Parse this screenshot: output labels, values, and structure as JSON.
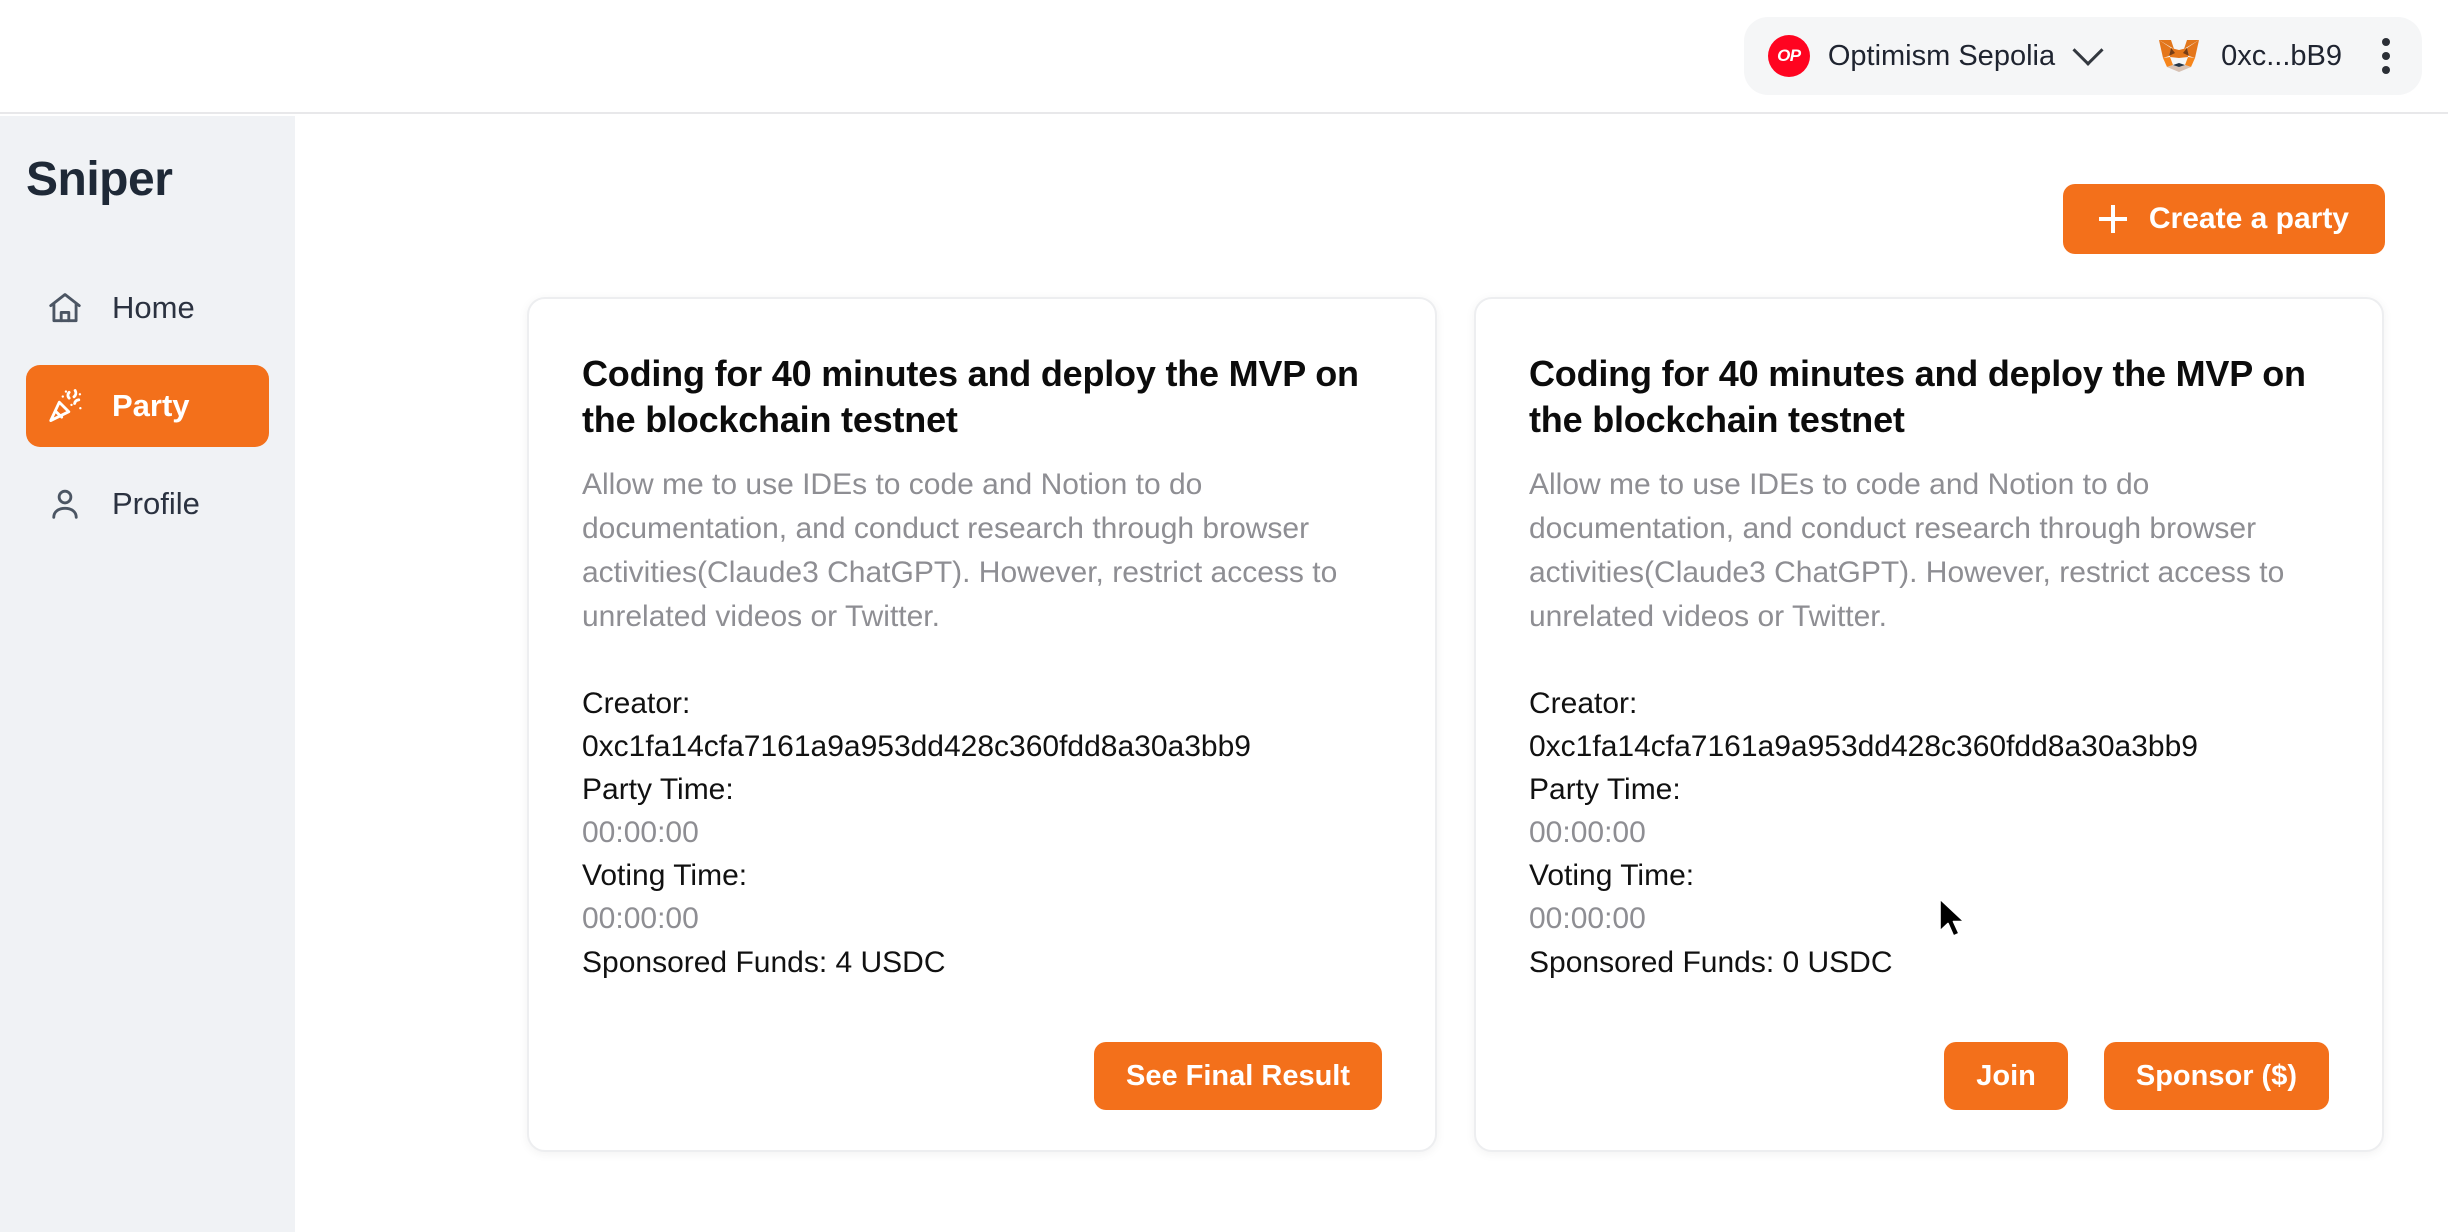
{
  "header": {
    "network": {
      "badge_text": "OP",
      "badge_color": "#ff0420",
      "name": "Optimism Sepolia",
      "chevron_icon": "chevron-down-icon"
    },
    "account": {
      "wallet_icon": "metamask-fox-icon",
      "address": "0xc...bB9"
    },
    "menu_icon": "kebab-menu-icon"
  },
  "sidebar": {
    "brand": "Sniper",
    "items": [
      {
        "label": "Home",
        "icon": "home-icon",
        "active": false
      },
      {
        "label": "Party",
        "icon": "party-popper-icon",
        "active": true
      },
      {
        "label": "Profile",
        "icon": "person-icon",
        "active": false
      }
    ]
  },
  "main": {
    "create_button": {
      "label": "Create a party",
      "icon": "plus-icon"
    },
    "accent_color": "#f3701b",
    "cards": [
      {
        "title": "Coding for 40 minutes and deploy the MVP on the blockchain testnet",
        "description": "Allow me to use IDEs to code and Notion to do documentation, and conduct research through browser activities(Claude3 ChatGPT). However, restrict access to unrelated videos or Twitter.",
        "creator_label": "Creator:",
        "creator_address": "0xc1fa14cfa7161a9a953dd428c360fdd8a30a3bb9",
        "party_time_label": "Party Time:",
        "party_time": "00:00:00",
        "voting_time_label": "Voting Time:",
        "voting_time": "00:00:00",
        "sponsored_funds": "Sponsored Funds: 4 USDC",
        "buttons": [
          "See Final Result"
        ]
      },
      {
        "title": "Coding for 40 minutes and deploy the MVP on the blockchain testnet",
        "description": "Allow me to use IDEs to code and Notion to do documentation, and conduct research through browser activities(Claude3 ChatGPT). However, restrict access to unrelated videos or Twitter.",
        "creator_label": "Creator:",
        "creator_address": "0xc1fa14cfa7161a9a953dd428c360fdd8a30a3bb9",
        "party_time_label": "Party Time:",
        "party_time": "00:00:00",
        "voting_time_label": "Voting Time:",
        "voting_time": "00:00:00",
        "sponsored_funds": "Sponsored Funds: 0 USDC",
        "buttons": [
          "Join",
          "Sponsor ($)"
        ]
      }
    ]
  }
}
